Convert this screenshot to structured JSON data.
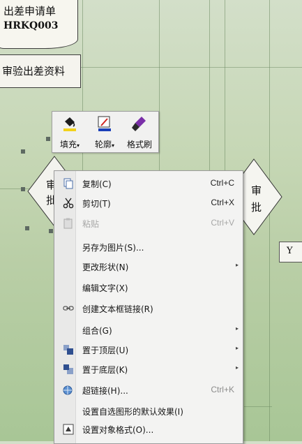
{
  "flowchart": {
    "doc_title": "出差申请单",
    "doc_code": "HRKQ003",
    "process_label": "审验出差资料",
    "left_decision_line1": "审",
    "left_decision_line2": "批",
    "right_decision_line1": "审",
    "right_decision_line2": "批",
    "y_label": "Y"
  },
  "mini_toolbar": {
    "fill_label": "填充",
    "outline_label": "轮廓",
    "format_painter_label": "格式刷",
    "dropdown_glyph": "▾"
  },
  "context_menu": {
    "items": [
      {
        "label": "复制(C)",
        "shortcut": "Ctrl+C",
        "icon": "copy-icon"
      },
      {
        "label": "剪切(T)",
        "shortcut": "Ctrl+X",
        "icon": "cut-icon"
      },
      {
        "label": "粘贴",
        "shortcut": "Ctrl+V",
        "icon": "paste-icon",
        "disabled": true
      },
      {
        "label": "另存为图片(S)...",
        "shortcut": ""
      },
      {
        "label": "更改形状(N)",
        "submenu": true
      },
      {
        "label": "编辑文字(X)",
        "shortcut": ""
      },
      {
        "label": "创建文本框链接(R)",
        "icon": "link-textbox-icon"
      },
      {
        "label": "组合(G)",
        "submenu": true
      },
      {
        "label": "置于顶层(U)",
        "submenu": true,
        "icon": "bring-to-front-icon"
      },
      {
        "label": "置于底层(K)",
        "submenu": true,
        "icon": "send-to-back-icon"
      },
      {
        "label": "超链接(H)...",
        "shortcut": "Ctrl+K",
        "icon": "hyperlink-icon"
      },
      {
        "label": "设置自选图形的默认效果(I)"
      },
      {
        "label": "设置对象格式(O)...",
        "icon": "format-object-icon"
      }
    ],
    "submenu_glyph": "▸"
  },
  "colors": {
    "fill_accent": "#f2d21b",
    "outline_accent": "#1a3fb8",
    "painter_accent": "#7a2fa8"
  }
}
